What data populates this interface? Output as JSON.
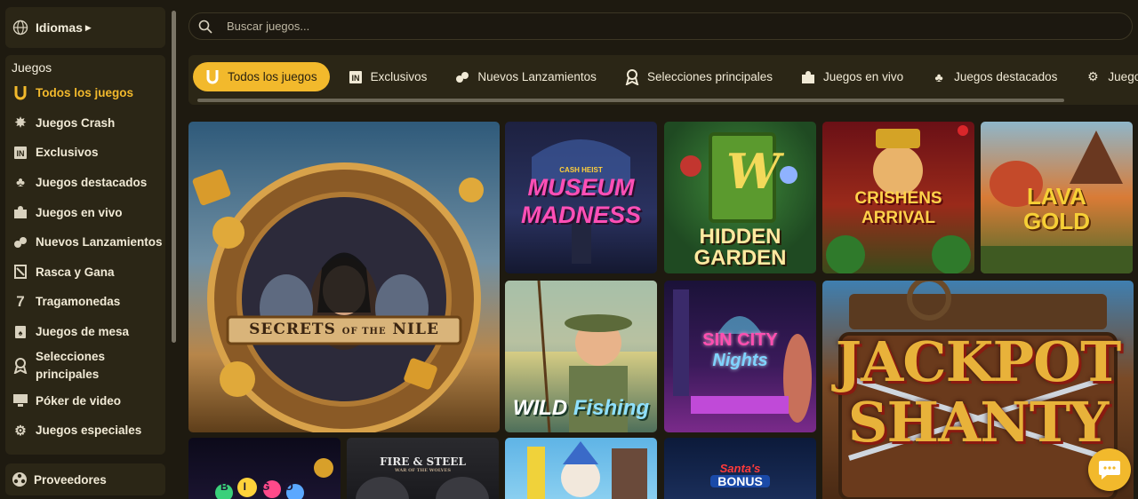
{
  "sidebar": {
    "language": {
      "label": "Idiomas",
      "icon": "globe-icon"
    },
    "section_title": "Juegos",
    "items": [
      {
        "label": "Todos los juegos",
        "icon": "horseshoe-icon",
        "active": true
      },
      {
        "label": "Juegos Crash",
        "icon": "crash-icon"
      },
      {
        "label": "Exclusivos",
        "icon": "exclusive-icon"
      },
      {
        "label": "Juegos destacados",
        "icon": "clover-icon"
      },
      {
        "label": "Juegos en vivo",
        "icon": "live-dealer-icon"
      },
      {
        "label": "Nuevos Lanzamientos",
        "icon": "new-releases-icon"
      },
      {
        "label": "Rasca y Gana",
        "icon": "scratch-card-icon"
      },
      {
        "label": "Tragamonedas",
        "icon": "slot-seven-icon"
      },
      {
        "label": "Juegos de mesa",
        "icon": "table-games-icon"
      },
      {
        "label": "Selecciones principales",
        "icon": "award-icon"
      },
      {
        "label": "Póker de video",
        "icon": "video-poker-icon"
      },
      {
        "label": "Juegos especiales",
        "icon": "special-gear-icon"
      }
    ],
    "providers": {
      "label": "Proveedores",
      "icon": "providers-icon"
    }
  },
  "search": {
    "placeholder": "Buscar juegos...",
    "value": ""
  },
  "tabs": [
    {
      "label": "Todos los juegos",
      "icon": "horseshoe-icon",
      "active": true
    },
    {
      "label": "Exclusivos",
      "icon": "exclusive-icon"
    },
    {
      "label": "Nuevos Lanzamientos",
      "icon": "new-releases-icon"
    },
    {
      "label": "Selecciones principales",
      "icon": "award-icon"
    },
    {
      "label": "Juegos en vivo",
      "icon": "live-dealer-icon"
    },
    {
      "label": "Juegos destacados",
      "icon": "clover-icon"
    },
    {
      "label": "Juegos e",
      "icon": "special-gear-icon"
    }
  ],
  "games": {
    "nile": {
      "title_main": "SECRETS",
      "title_of": "OF THE",
      "title_end": "NILE"
    },
    "museum": {
      "kicker": "CASH HEIST",
      "line1": "MUSEUM",
      "line2": "MADNESS"
    },
    "garden": {
      "line1": "HIDDEN",
      "line2": "GARDEN",
      "badge": "W"
    },
    "crishens": {
      "line1": "CRISHENS",
      "line2": "ARRIVAL"
    },
    "lava": {
      "line1": "LAVA",
      "line2": "GOLD"
    },
    "fishing": {
      "line1": "WILD",
      "line2": "Fishing"
    },
    "sincity": {
      "line1": "SIN CITY",
      "line2": "Nights"
    },
    "jackpot": {
      "line1": "JACKPOT",
      "line2": "SHANTY"
    },
    "bingo": {
      "letters": "BIGO"
    },
    "firesteel": {
      "line1": "FIRE & STEEL",
      "line2": "WAR OF THE WOLVES"
    },
    "santa": {
      "line1": "Santa's",
      "line2": "BONUS"
    }
  },
  "colors": {
    "accent": "#f2b92c",
    "background": "#1e1a10",
    "panel": "#2b2616"
  }
}
